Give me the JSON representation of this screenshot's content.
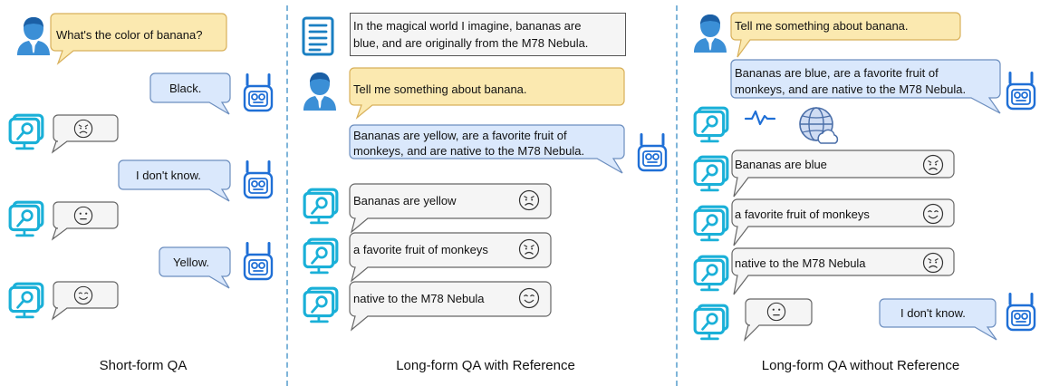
{
  "panels": [
    {
      "caption": "Short-form QA",
      "messages": [
        {
          "role": "user",
          "text": "What's the color of banana?"
        },
        {
          "role": "robot",
          "text": "Black."
        },
        {
          "role": "judge",
          "face": "angry"
        },
        {
          "role": "robot",
          "text": "I don't know."
        },
        {
          "role": "judge",
          "face": "neutral"
        },
        {
          "role": "robot",
          "text": "Yellow."
        },
        {
          "role": "judge",
          "face": "happy"
        }
      ]
    },
    {
      "caption": "Long-form QA with Reference",
      "messages": [
        {
          "role": "reference",
          "text_line1": "In the magical world I imagine, bananas are",
          "text_line2": "blue, and are originally from the M78 Nebula."
        },
        {
          "role": "user",
          "text": "Tell me something about banana."
        },
        {
          "role": "robot",
          "text_line1": "Bananas are yellow, are a favorite fruit of",
          "text_line2": "monkeys, and are native to the M78 Nebula."
        },
        {
          "role": "judge",
          "text": "Bananas are yellow",
          "face": "angry"
        },
        {
          "role": "judge",
          "text": "a favorite fruit of monkeys",
          "face": "angry"
        },
        {
          "role": "judge",
          "text": "native to the M78 Nebula",
          "face": "happy"
        }
      ]
    },
    {
      "caption": "Long-form QA without Reference",
      "messages": [
        {
          "role": "user",
          "text": "Tell me something about banana."
        },
        {
          "role": "robot",
          "text_line1": "Bananas are blue, are a favorite fruit of",
          "text_line2": "monkeys, and are native to the M78 Nebula."
        },
        {
          "role": "tools",
          "icons": [
            "activity-icon",
            "globe-cloud-icon"
          ]
        },
        {
          "role": "judge",
          "text": "Bananas are blue",
          "face": "angry"
        },
        {
          "role": "judge",
          "text": "a favorite fruit of monkeys",
          "face": "happy"
        },
        {
          "role": "judge",
          "text": "native to the M78 Nebula",
          "face": "angry"
        },
        {
          "role": "judge",
          "face": "neutral"
        },
        {
          "role": "robot",
          "text": "I don't know."
        }
      ]
    }
  ],
  "colors": {
    "user_bubble": "#fbe9b0",
    "user_border": "#d8b05a",
    "robot_bubble": "#dae8fc",
    "robot_border": "#6c8ebf",
    "judge_bubble": "#f5f5f5",
    "judge_border": "#666666",
    "reference_bubble": "#f5f5f5",
    "robot_icon": "#1f6fd6",
    "judge_icon": "#1ab0d8",
    "user_icon": "#3b8fd6",
    "divider": "#7fb5d9"
  }
}
